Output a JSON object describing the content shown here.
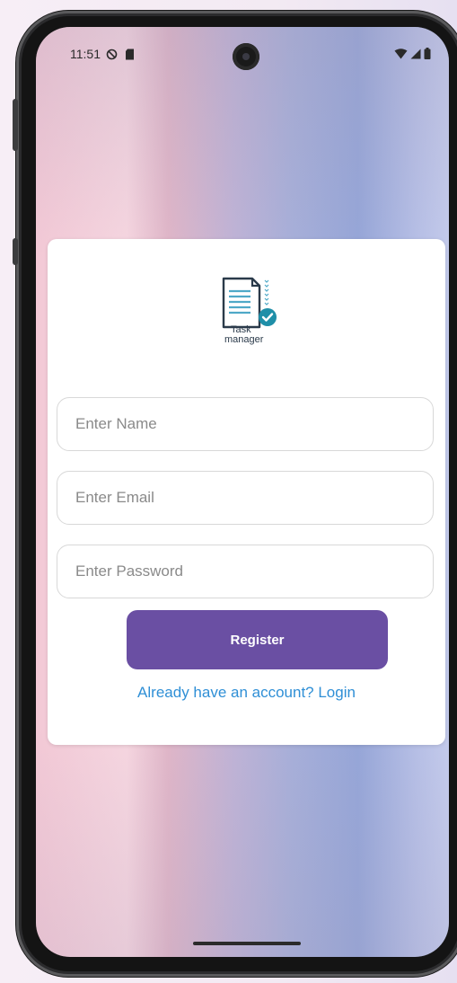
{
  "status_bar": {
    "time": "11:51",
    "left_icons": [
      "do-not-disturb-icon",
      "sd-card-icon"
    ],
    "right_icons": [
      "wifi-icon",
      "signal-icon",
      "battery-icon"
    ]
  },
  "logo": {
    "line1": "Task",
    "line2": "manager"
  },
  "form": {
    "name_placeholder": "Enter Name",
    "email_placeholder": "Enter Email",
    "password_placeholder": "Enter Password",
    "name_value": "",
    "email_value": "",
    "password_value": "",
    "register_label": "Register",
    "login_link": "Already have an account? Login"
  },
  "colors": {
    "primary": "#6a4fa3",
    "link": "#2f8fd6",
    "logo_accent": "#1f8fa8"
  }
}
